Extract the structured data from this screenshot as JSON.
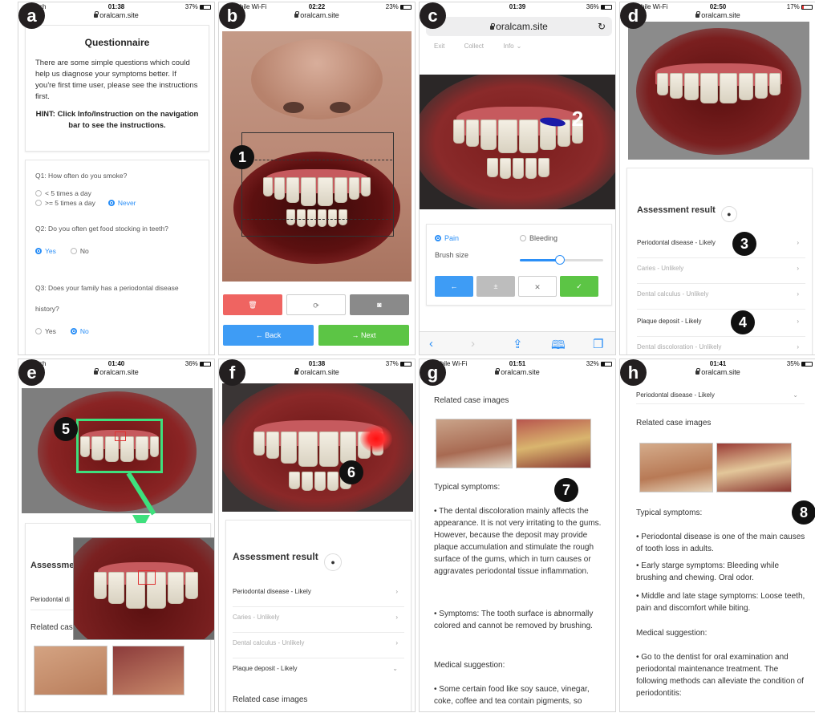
{
  "url": "oralcam.site",
  "panels": {
    "a": {
      "label": "a",
      "carrier": "ch",
      "time": "01:38",
      "battery": "37%",
      "title": "Questionnaire",
      "intro": "There are some simple questions which could help us diagnose your symptoms better. If you're first time user, please see the instructions first.",
      "hint": "HINT: Click Info/Instruction on the navigation bar to see the instructions.",
      "q1": "Q1: How often do you smoke?",
      "q1_opt1": "< 5 times a day",
      "q1_opt2": ">= 5 times a day",
      "q1_opt3": "Never",
      "q2": "Q2: Do you often get food stocking in teeth?",
      "q2_yes": "Yes",
      "q2_no": "No",
      "q3": "Q3: Does your family has a periodontal disease history?",
      "q3_yes": "Yes",
      "q3_no": "No"
    },
    "b": {
      "label": "b",
      "carrier": "bile Wi-Fi",
      "time": "02:22",
      "battery": "23%",
      "marker": "1",
      "back": "← Back",
      "next": "→ Next"
    },
    "c": {
      "label": "c",
      "carrier": "",
      "time": "01:39",
      "battery": "36%",
      "nav_exit": "Exit",
      "nav_collect": "Collect",
      "nav_info": "Info",
      "marker": "2",
      "pain": "Pain",
      "bleeding": "Bleeding",
      "brush_size": "Brush size",
      "brush_value_fraction": 0.48
    },
    "d": {
      "label": "d",
      "carrier": "bile Wi-Fi",
      "time": "02:50",
      "battery": "17%",
      "assessment_title": "Assessment result",
      "r1": "Periodontal disease - Likely",
      "r2": "Caries - Unlikely",
      "r3": "Dental calculus - Unlikely",
      "r4": "Plaque deposit - Likely",
      "r5": "Dental discoloration - Unlikely",
      "marker3": "3",
      "marker4": "4"
    },
    "e": {
      "label": "e",
      "carrier": "ch",
      "time": "01:40",
      "battery": "36%",
      "marker": "5",
      "assessment_title": "Assessme",
      "r1": "Periodontal di",
      "related": "Related cas"
    },
    "f": {
      "label": "f",
      "carrier": "",
      "time": "01:38",
      "battery": "37%",
      "marker": "6",
      "assessment_title": "Assessment result",
      "r1": "Periodontal disease - Likely",
      "r2": "Caries - Unlikely",
      "r3": "Dental calculus - Unlikely",
      "r4": "Plaque deposit - Likely",
      "related": "Related case images"
    },
    "g": {
      "label": "g",
      "carrier": "bile Wi-Fi",
      "time": "01:51",
      "battery": "32%",
      "related": "Related case images",
      "typical": "Typical symptoms:",
      "marker": "7",
      "p1": "• The dental discoloration mainly affects the appearance. It is not very irritating to the gums. However, because the deposit may provide plaque accumulation and stimulate the rough surface of the gums, which in turn causes or aggravates periodontal tissue inflammation.",
      "p2": "• Symptoms: The tooth surface is abnormally colored and cannot be removed by brushing.",
      "medical": "Medical suggestion:",
      "p3": "• Some certain food like soy sauce, vinegar, coke, coffee and tea contain pigments, so"
    },
    "h": {
      "label": "h",
      "carrier": "",
      "time": "01:41",
      "battery": "35%",
      "header_row": "Periodontal disease - Likely",
      "related": "Related case images",
      "typical": "Typical symptoms:",
      "marker": "8",
      "p1": "• Periodontal disease is one of the main causes of tooth loss in adults.",
      "p2": "• Early starge symptoms: Bleeding while brushing and chewing. Oral odor.",
      "p3": "• Middle and late stage symptoms: Loose teeth, pain and discomfort while biting.",
      "medical": "Medical suggestion:",
      "p4": "• Go to the dentist for oral examination and periodontal maintenance treatment. The following methods can alleviate the condition of periodontitis:"
    }
  },
  "colors": {
    "accent_blue": "#2b8ff7",
    "delete_red": "#ef6461",
    "confirm_green": "#5cc545",
    "neutral_gray": "#9e9e9e",
    "highlight_green": "#3ee07d"
  },
  "icons": [
    "trash-icon",
    "refresh-icon",
    "camera-icon",
    "chevron-right-icon",
    "help-icon",
    "share-icon",
    "book-icon",
    "tabs-icon",
    "reload-icon",
    "lock-icon"
  ]
}
